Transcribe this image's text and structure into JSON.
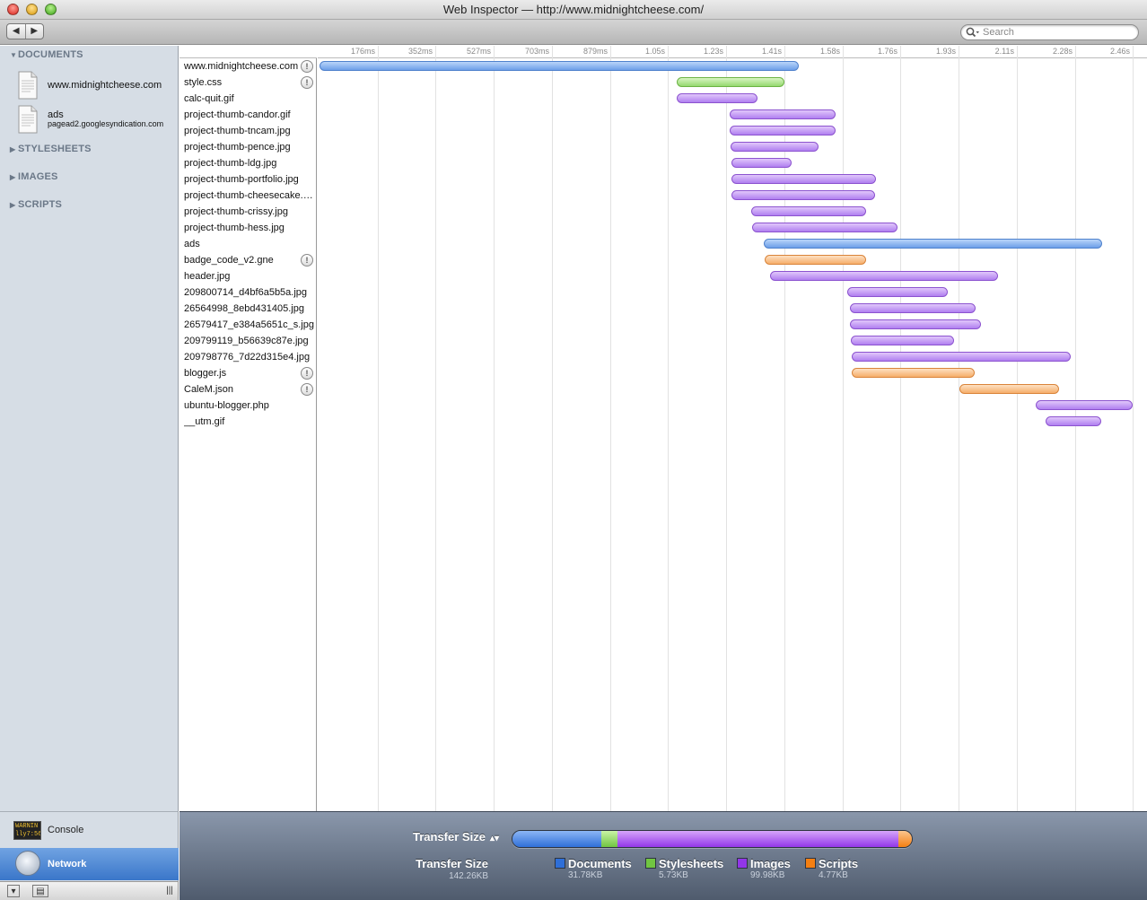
{
  "window": {
    "title": "Web Inspector — http://www.midnightcheese.com/"
  },
  "toolbar": {
    "back_label": "◀",
    "forward_label": "▶",
    "search_placeholder": "Search"
  },
  "sidebar": {
    "sections": [
      {
        "label": "DOCUMENTS",
        "expanded": true
      },
      {
        "label": "STYLESHEETS",
        "expanded": false
      },
      {
        "label": "IMAGES",
        "expanded": false
      },
      {
        "label": "SCRIPTS",
        "expanded": false
      }
    ],
    "documents": [
      {
        "name": "www.midnightcheese.com",
        "subtitle": ""
      },
      {
        "name": "ads",
        "subtitle": "pagead2.googlesyndication.com"
      }
    ]
  },
  "panels": {
    "console_label": "Console",
    "console_icon_text": "WARNIN\nlly7:56",
    "network_label": "Network"
  },
  "timeline": {
    "ticks": [
      "176ms",
      "352ms",
      "527ms",
      "703ms",
      "879ms",
      "1.05s",
      "1.23s",
      "1.41s",
      "1.58s",
      "1.76s",
      "1.93s",
      "2.11s",
      "2.28s",
      "2.46s"
    ],
    "tick_step_s": 0.1757,
    "colors": {
      "document": "#6d9fe8",
      "stylesheet": "#94d86f",
      "image": "#b07ff0",
      "script": "#f6ae6a"
    },
    "resources": [
      {
        "name": "www.midnightcheese.com",
        "type": "document",
        "start": 0.0,
        "end": 1.449,
        "warning": true
      },
      {
        "name": "style.css",
        "type": "stylesheet",
        "start": 1.079,
        "end": 1.404,
        "warning": true
      },
      {
        "name": "calc-quit.gif",
        "type": "image",
        "start": 1.079,
        "end": 1.323,
        "warning": false
      },
      {
        "name": "project-thumb-candor.gif",
        "type": "image",
        "start": 1.241,
        "end": 1.562,
        "warning": false
      },
      {
        "name": "project-thumb-tncam.jpg",
        "type": "image",
        "start": 1.241,
        "end": 1.562,
        "warning": false
      },
      {
        "name": "project-thumb-pence.jpg",
        "type": "image",
        "start": 1.244,
        "end": 1.51,
        "warning": false
      },
      {
        "name": "project-thumb-ldg.jpg",
        "type": "image",
        "start": 1.246,
        "end": 1.428,
        "warning": false
      },
      {
        "name": "project-thumb-portfolio.jpg",
        "type": "image",
        "start": 1.246,
        "end": 1.682,
        "warning": false
      },
      {
        "name": "project-thumb-cheesecake.jpg",
        "type": "image",
        "start": 1.246,
        "end": 1.68,
        "warning": false
      },
      {
        "name": "project-thumb-crissy.jpg",
        "type": "image",
        "start": 1.304,
        "end": 1.65,
        "warning": false
      },
      {
        "name": "project-thumb-hess.jpg",
        "type": "image",
        "start": 1.307,
        "end": 1.747,
        "warning": false
      },
      {
        "name": "ads",
        "type": "document",
        "start": 1.342,
        "end": 2.364,
        "warning": false
      },
      {
        "name": "badge_code_v2.gne",
        "type": "script",
        "start": 1.345,
        "end": 1.652,
        "warning": true
      },
      {
        "name": "header.jpg",
        "type": "image",
        "start": 1.363,
        "end": 2.051,
        "warning": false
      },
      {
        "name": "209800714_d4bf6a5b5a.jpg",
        "type": "image",
        "start": 1.595,
        "end": 1.9,
        "warning": false
      },
      {
        "name": "26564998_8ebd431405.jpg",
        "type": "image",
        "start": 1.603,
        "end": 1.982,
        "warning": false
      },
      {
        "name": "26579417_e384a5651c_s.jpg",
        "type": "image",
        "start": 1.603,
        "end": 1.998,
        "warning": false
      },
      {
        "name": "209799119_b56639c87e.jpg",
        "type": "image",
        "start": 1.606,
        "end": 1.918,
        "warning": false
      },
      {
        "name": "209798776_7d22d315e4.jpg",
        "type": "image",
        "start": 1.609,
        "end": 2.271,
        "warning": false
      },
      {
        "name": "blogger.js",
        "type": "script",
        "start": 1.609,
        "end": 1.982,
        "warning": true
      },
      {
        "name": "CaleM.json",
        "type": "script",
        "start": 1.935,
        "end": 2.235,
        "warning": true
      },
      {
        "name": "ubuntu-blogger.php",
        "type": "image",
        "start": 2.166,
        "end": 2.459,
        "warning": false
      },
      {
        "name": "__utm.gif",
        "type": "image",
        "start": 2.195,
        "end": 2.364,
        "warning": false
      }
    ]
  },
  "summary": {
    "selector_label": "Transfer Size",
    "total_label": "Transfer Size",
    "total_value": "142.26KB",
    "categories": [
      {
        "name": "Documents",
        "size": "31.78KB",
        "kb": 31.78,
        "color": "#2f6fd8"
      },
      {
        "name": "Stylesheets",
        "size": "5.73KB",
        "kb": 5.73,
        "color": "#71c542"
      },
      {
        "name": "Images",
        "size": "99.98KB",
        "kb": 99.98,
        "color": "#9236e8"
      },
      {
        "name": "Scripts",
        "size": "4.77KB",
        "kb": 4.77,
        "color": "#f47f12"
      }
    ]
  }
}
